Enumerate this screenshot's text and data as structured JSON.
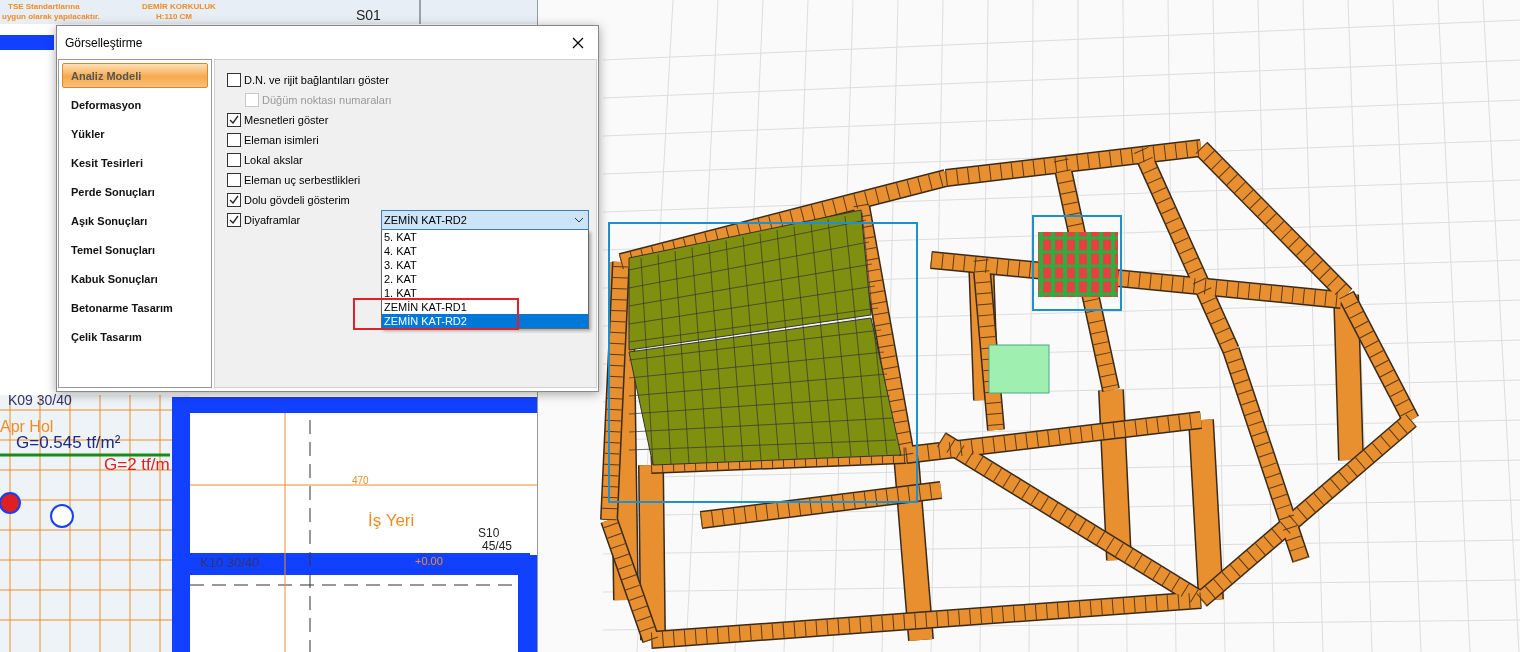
{
  "plan_view": {
    "labels": [
      {
        "text": "TSE Standartlarına",
        "color": "#f08c28"
      },
      {
        "text": "uygun olarak yapılacaktır.",
        "color": "#f08c28"
      },
      {
        "text": "DEMİR KORKULUK",
        "color": "#f08c28"
      },
      {
        "text": "H:110 CM",
        "color": "#f08c28"
      },
      {
        "text": "S01",
        "color": "#222222"
      },
      {
        "text": "K09 30/40",
        "color": "#333366"
      },
      {
        "text": "Apr Hol",
        "color": "#f08c28"
      },
      {
        "text": "G=0.545 tf/m²",
        "color": "#1e2a80"
      },
      {
        "text": "G=2 tf/m",
        "color": "#e02020"
      },
      {
        "text": "470",
        "color": "#f08c28"
      },
      {
        "text": "İş Yeri",
        "color": "#f08c28"
      },
      {
        "text": "S10",
        "color": "#222222"
      },
      {
        "text": "45/45",
        "color": "#222222"
      },
      {
        "text": "K10 30/40",
        "color": "#333366"
      },
      {
        "text": "+0.00",
        "color": "#f08c28"
      }
    ]
  },
  "dialog": {
    "title": "Görselleştirme",
    "sidebar": [
      {
        "label": "Analiz Modeli",
        "selected": true
      },
      {
        "label": "Deformasyon",
        "selected": false
      },
      {
        "label": "Yükler",
        "selected": false
      },
      {
        "label": "Kesit Tesirleri",
        "selected": false
      },
      {
        "label": "Perde Sonuçları",
        "selected": false
      },
      {
        "label": "Aşık Sonuçları",
        "selected": false
      },
      {
        "label": "Temel Sonuçları",
        "selected": false
      },
      {
        "label": "Kabuk Sonuçları",
        "selected": false
      },
      {
        "label": "Betonarme Tasarım",
        "selected": false
      },
      {
        "label": "Çelik Tasarım",
        "selected": false
      }
    ],
    "options": [
      {
        "label": "D.N. ve rijit bağlantıları göster",
        "checked": false,
        "disabled": false,
        "children": [
          {
            "label": "Düğüm noktası numaraları",
            "checked": false,
            "disabled": true
          }
        ]
      },
      {
        "label": "Mesnetleri göster",
        "checked": true,
        "disabled": false
      },
      {
        "label": "Eleman isimleri",
        "checked": false,
        "disabled": false
      },
      {
        "label": "Lokal akslar",
        "checked": false,
        "disabled": false
      },
      {
        "label": "Eleman uç serbestlikleri",
        "checked": false,
        "disabled": false
      },
      {
        "label": "Dolu gövdeli gösterim",
        "checked": true,
        "disabled": false
      },
      {
        "label": "Diyaframlar",
        "checked": true,
        "disabled": false,
        "dropdown": {
          "value": "ZEMİN KAT-RD2",
          "expanded": true,
          "items": [
            {
              "label": "5. KAT",
              "selected": false
            },
            {
              "label": "4. KAT",
              "selected": false
            },
            {
              "label": "3. KAT",
              "selected": false
            },
            {
              "label": "2. KAT",
              "selected": false
            },
            {
              "label": "1. KAT",
              "selected": false
            },
            {
              "label": "ZEMİN KAT-RD1",
              "selected": false
            },
            {
              "label": "ZEMİN KAT-RD2",
              "selected": true
            }
          ]
        }
      }
    ]
  }
}
